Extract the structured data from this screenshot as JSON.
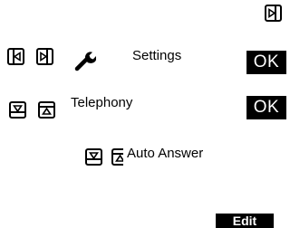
{
  "menu_path": [
    {
      "label": "Settings",
      "icon": "wrench-icon"
    },
    {
      "label": "Telephony"
    },
    {
      "label": "Auto Answer"
    }
  ],
  "softkeys": {
    "ok_1": "OK",
    "ok_2": "OK",
    "edit": "Edit"
  },
  "icons": {
    "control_key_right": "control-key-right-icon",
    "control_key_left": "control-key-left-icon",
    "control_key_down": "control-key-down-icon",
    "control_key_up": "control-key-up-icon",
    "wrench": "wrench-icon"
  },
  "colors": {
    "background": "#ffffff",
    "softkey_background": "#000000",
    "softkey_text": "#ffffff",
    "text": "#000000"
  }
}
